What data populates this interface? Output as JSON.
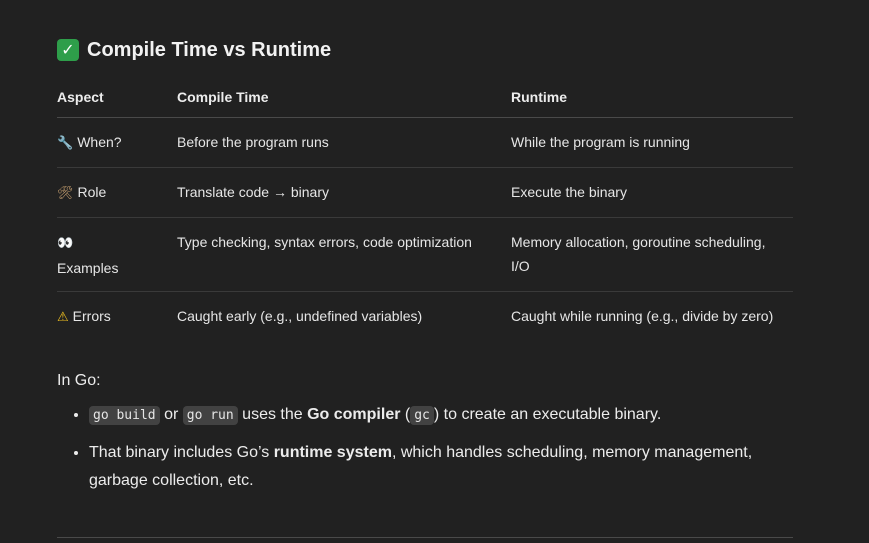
{
  "heading": {
    "icon": "check-mark-icon",
    "icon_glyph": "✓",
    "title": "Compile Time vs Runtime"
  },
  "table": {
    "headers": [
      "Aspect",
      "Compile Time",
      "Runtime"
    ],
    "rows": [
      {
        "icon": "wrench-icon",
        "glyph": "🔧",
        "aspect": "When?",
        "compile": "Before the program runs",
        "runtime": "While the program is running"
      },
      {
        "icon": "hammer-wrench-icon",
        "glyph": "🛠",
        "aspect": "Role",
        "compile": "Translate code → binary",
        "runtime": "Execute the binary"
      },
      {
        "icon": "eyes-icon",
        "glyph": "👀",
        "aspect": "Examples",
        "compile": "Type checking, syntax errors, code optimization",
        "runtime": "Memory allocation, goroutine scheduling, I/O"
      },
      {
        "icon": "warning-icon",
        "glyph": "⚠",
        "aspect": "Errors",
        "compile": "Caught early (e.g., undefined variables)",
        "runtime": "Caught while running (e.g., divide by zero)"
      }
    ]
  },
  "intro": "In Go:",
  "bullets": {
    "b1": {
      "code1": "go build",
      "t1": " or ",
      "code2": "go run",
      "t2": " uses the ",
      "bold": "Go compiler",
      "t3": " (",
      "code3": "gc",
      "t4": ") to create an executable binary."
    },
    "b2": {
      "t1": "That binary includes Go’s ",
      "bold": "runtime system",
      "t2": ", which handles scheduling, memory management, garbage collection, etc."
    }
  }
}
